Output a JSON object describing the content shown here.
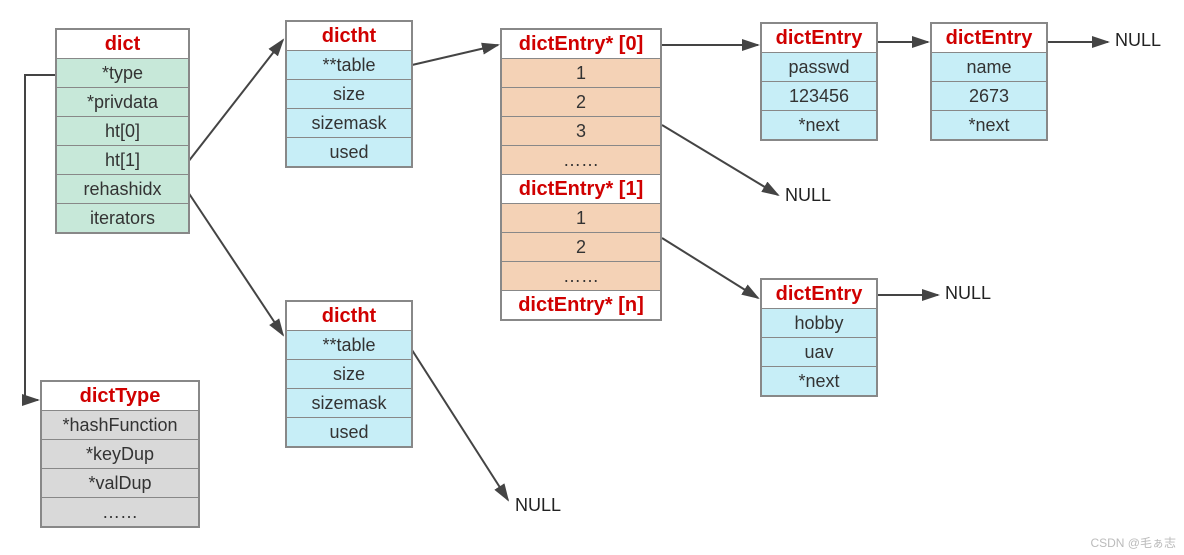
{
  "dict": {
    "title": "dict",
    "fields": [
      "*type",
      "*privdata",
      "ht[0]",
      "ht[1]",
      "rehashidx",
      "iterators"
    ]
  },
  "dictType": {
    "title": "dictType",
    "fields": [
      "*hashFunction",
      "*keyDup",
      "*valDup",
      "……"
    ]
  },
  "dictht0": {
    "title": "dictht",
    "fields": [
      "**table",
      "size",
      "sizemask",
      "used"
    ]
  },
  "dictht1": {
    "title": "dictht",
    "fields": [
      "**table",
      "size",
      "sizemask",
      "used"
    ]
  },
  "table": {
    "header0": "dictEntry* [0]",
    "slots0": [
      "1",
      "2",
      "3",
      "……"
    ],
    "header1": "dictEntry* [1]",
    "slots1": [
      "1",
      "2",
      "……"
    ],
    "headerN": "dictEntry* [n]"
  },
  "entry0": {
    "title": "dictEntry",
    "key": "passwd",
    "val": "123456",
    "next": "*next"
  },
  "entry1": {
    "title": "dictEntry",
    "key": "name",
    "val": "2673",
    "next": "*next"
  },
  "entry2": {
    "title": "dictEntry",
    "key": "hobby",
    "val": "uav",
    "next": "*next"
  },
  "nulls": {
    "n0": "NULL",
    "n1": "NULL",
    "n2": "NULL",
    "n3": "NULL"
  },
  "watermark": "CSDN @毛ぁ志"
}
